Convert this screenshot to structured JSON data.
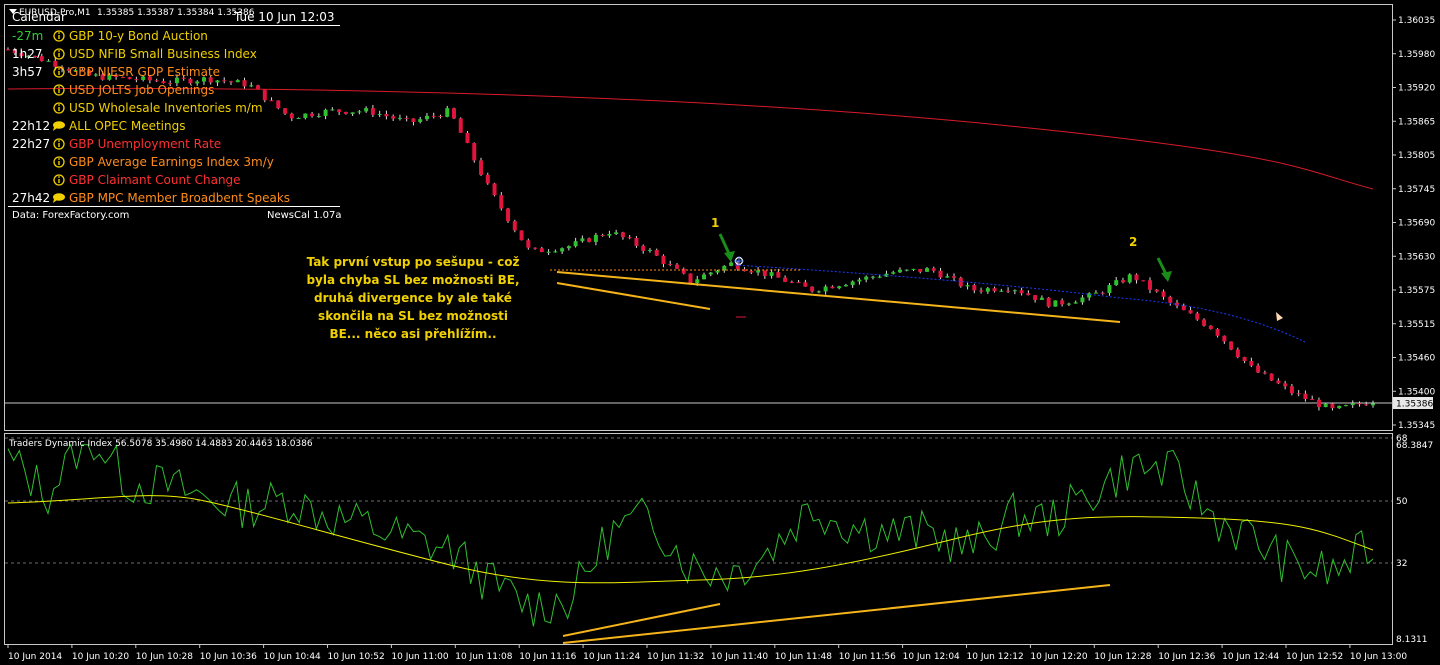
{
  "window": {
    "symbol_title": "EURUSD-Pro,M1",
    "ohlc": "1.35385 1.35387 1.35384 1.35386"
  },
  "calendar": {
    "title": "Calendar",
    "datetime": "Tue 10 Jun 12:03",
    "events": [
      {
        "time": "-27m",
        "icon": "info-icon",
        "currency": "GBP",
        "name": "10-y Bond Auction",
        "color": "#f0d000",
        "time_color": "#33cc33"
      },
      {
        "time": "1h27",
        "icon": "info-icon",
        "currency": "USD",
        "name": "NFIB Small Business Index",
        "color": "#f0d000",
        "time_color": "#ffffff"
      },
      {
        "time": "3h57",
        "icon": "info-icon",
        "currency": "GBP",
        "name": "NIESR GDP Estimate",
        "color": "#ff8c1a",
        "time_color": "#ffffff"
      },
      {
        "time": "",
        "icon": "info-icon",
        "currency": "USD",
        "name": "JOLTS Job Openings",
        "color": "#ff8c1a",
        "time_color": "#ffffff"
      },
      {
        "time": "",
        "icon": "info-icon",
        "currency": "USD",
        "name": "Wholesale Inventories m/m",
        "color": "#f0d000",
        "time_color": "#ffffff"
      },
      {
        "time": "22h12",
        "icon": "speech-icon",
        "currency": "ALL",
        "name": " OPEC Meetings",
        "color": "#f0d000",
        "time_color": "#ffffff"
      },
      {
        "time": "22h27",
        "icon": "info-icon",
        "currency": "GBP",
        "name": "Unemployment Rate",
        "color": "#ff3030",
        "time_color": "#ffffff"
      },
      {
        "time": "",
        "icon": "info-icon",
        "currency": "GBP",
        "name": "Average Earnings Index 3m/y",
        "color": "#ff8c1a",
        "time_color": "#ffffff"
      },
      {
        "time": "",
        "icon": "info-icon",
        "currency": "GBP",
        "name": "Claimant Count Change",
        "color": "#ff3030",
        "time_color": "#ffffff"
      },
      {
        "time": "27h42",
        "icon": "speech-icon",
        "currency": "GBP",
        "name": "MPC Member Broadbent Speaks",
        "color": "#ff8c1a",
        "time_color": "#ffffff"
      }
    ],
    "source": "Data: ForexFactory.com",
    "version": "NewsCal 1.07a"
  },
  "annotation": {
    "lines": [
      "Tak první vstup po sešupu - což",
      "byla chyba SL bez možnosti BE,",
      "druhá divergence by ale také",
      "skončila na SL bez možnosti",
      "BE... něco asi přehlížím.."
    ],
    "marker1": "1",
    "marker2": "2"
  },
  "price_axis": {
    "labels": [
      "1.36035",
      "1.35980",
      "1.35920",
      "1.35865",
      "1.35805",
      "1.35745",
      "1.35690",
      "1.35630",
      "1.35575",
      "1.35515",
      "1.35460",
      "1.35400",
      "1.35345"
    ],
    "current_price": "1.35386"
  },
  "indicator": {
    "title": "Traders Dynamic Index 56.5078 35.4980 14.4883 20.4463 18.0386",
    "axis_labels": [
      "68",
      "68.3847",
      "50",
      "32",
      "8.1311"
    ]
  },
  "time_axis": {
    "labels": [
      "10 Jun 2014",
      "10 Jun 10:20",
      "10 Jun 10:28",
      "10 Jun 10:36",
      "10 Jun 10:44",
      "10 Jun 10:52",
      "10 Jun 11:00",
      "10 Jun 11:08",
      "10 Jun 11:16",
      "10 Jun 11:24",
      "10 Jun 11:32",
      "10 Jun 11:40",
      "10 Jun 11:48",
      "10 Jun 11:56",
      "10 Jun 12:04",
      "10 Jun 12:12",
      "10 Jun 12:20",
      "10 Jun 12:28",
      "10 Jun 12:36",
      "10 Jun 12:44",
      "10 Jun 12:52",
      "10 Jun 13:00"
    ]
  },
  "chart_data": {
    "type": "candlestick",
    "series": [
      {
        "name": "EURUSD-Pro,M1",
        "close_path": [
          1.35985,
          1.35965,
          1.3594,
          1.35935,
          1.3593,
          1.35935,
          1.35925,
          1.3587,
          1.3588,
          1.3588,
          1.3586,
          1.3588,
          1.35745,
          1.3564,
          1.3565,
          1.35675,
          1.3564,
          1.3559,
          1.3562,
          1.356,
          1.35575,
          1.3559,
          1.35605,
          1.3561,
          1.35575,
          1.3558,
          1.3555,
          1.35565,
          1.356,
          1.3555,
          1.3551,
          1.3544,
          1.354,
          1.3537,
          1.35386
        ]
      },
      {
        "name": "Traders Dynamic Index",
        "values": [
          62,
          52,
          70,
          55,
          54,
          50,
          48,
          50,
          45,
          42,
          38,
          35,
          25,
          18,
          20,
          40,
          45,
          30,
          28,
          35,
          48,
          42,
          40,
          40,
          35,
          45,
          44,
          52,
          60,
          58,
          45,
          38,
          30,
          28,
          36
        ]
      }
    ],
    "ylim_price": [
      1.35345,
      1.36035
    ],
    "ylim_indicator": [
      8.1311,
      68.3847
    ],
    "indicator_levels": [
      32,
      50,
      68
    ]
  }
}
